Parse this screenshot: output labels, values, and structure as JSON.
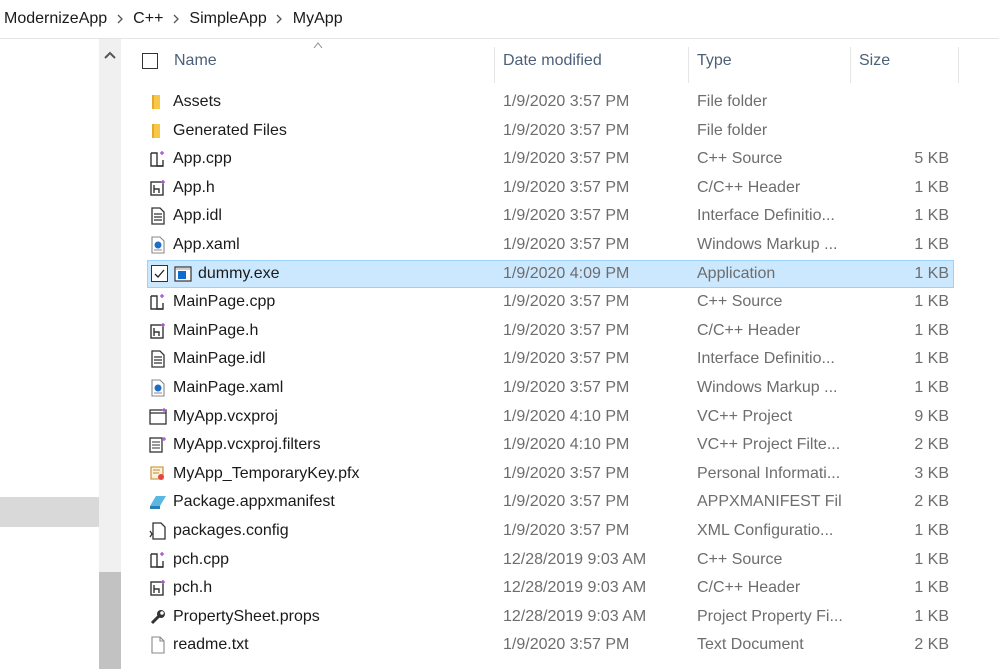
{
  "breadcrumb": [
    "ModernizeApp",
    "C++",
    "SimpleApp",
    "MyApp"
  ],
  "columns": {
    "name": "Name",
    "date": "Date modified",
    "type": "Type",
    "size": "Size"
  },
  "files": [
    {
      "name": "Assets",
      "date": "1/9/2020 3:57 PM",
      "type": "File folder",
      "size": "",
      "icon": "folder-icon"
    },
    {
      "name": "Generated Files",
      "date": "1/9/2020 3:57 PM",
      "type": "File folder",
      "size": "",
      "icon": "folder-icon"
    },
    {
      "name": "App.cpp",
      "date": "1/9/2020 3:57 PM",
      "type": "C++ Source",
      "size": "5 KB",
      "icon": "cpp-file-icon"
    },
    {
      "name": "App.h",
      "date": "1/9/2020 3:57 PM",
      "type": "C/C++ Header",
      "size": "1 KB",
      "icon": "header-file-icon"
    },
    {
      "name": "App.idl",
      "date": "1/9/2020 3:57 PM",
      "type": "Interface Definitio...",
      "size": "1 KB",
      "icon": "text-file-icon"
    },
    {
      "name": "App.xaml",
      "date": "1/9/2020 3:57 PM",
      "type": "Windows Markup ...",
      "size": "1 KB",
      "icon": "xaml-file-icon"
    },
    {
      "name": "dummy.exe",
      "date": "1/9/2020 4:09 PM",
      "type": "Application",
      "size": "1 KB",
      "icon": "application-icon",
      "selected": true
    },
    {
      "name": "MainPage.cpp",
      "date": "1/9/2020 3:57 PM",
      "type": "C++ Source",
      "size": "1 KB",
      "icon": "cpp-file-icon"
    },
    {
      "name": "MainPage.h",
      "date": "1/9/2020 3:57 PM",
      "type": "C/C++ Header",
      "size": "1 KB",
      "icon": "header-file-icon"
    },
    {
      "name": "MainPage.idl",
      "date": "1/9/2020 3:57 PM",
      "type": "Interface Definitio...",
      "size": "1 KB",
      "icon": "text-file-icon"
    },
    {
      "name": "MainPage.xaml",
      "date": "1/9/2020 3:57 PM",
      "type": "Windows Markup ...",
      "size": "1 KB",
      "icon": "xaml-file-icon"
    },
    {
      "name": "MyApp.vcxproj",
      "date": "1/9/2020 4:10 PM",
      "type": "VC++ Project",
      "size": "9 KB",
      "icon": "vcxproj-file-icon"
    },
    {
      "name": "MyApp.vcxproj.filters",
      "date": "1/9/2020 4:10 PM",
      "type": "VC++ Project Filte...",
      "size": "2 KB",
      "icon": "filters-file-icon"
    },
    {
      "name": "MyApp_TemporaryKey.pfx",
      "date": "1/9/2020 3:57 PM",
      "type": "Personal Informati...",
      "size": "3 KB",
      "icon": "certificate-file-icon"
    },
    {
      "name": "Package.appxmanifest",
      "date": "1/9/2020 3:57 PM",
      "type": "APPXMANIFEST File",
      "size": "2 KB",
      "icon": "manifest-file-icon"
    },
    {
      "name": "packages.config",
      "date": "1/9/2020 3:57 PM",
      "type": "XML Configuratio...",
      "size": "1 KB",
      "icon": "config-file-icon"
    },
    {
      "name": "pch.cpp",
      "date": "12/28/2019 9:03 AM",
      "type": "C++ Source",
      "size": "1 KB",
      "icon": "cpp-file-icon"
    },
    {
      "name": "pch.h",
      "date": "12/28/2019 9:03 AM",
      "type": "C/C++ Header",
      "size": "1 KB",
      "icon": "header-file-icon"
    },
    {
      "name": "PropertySheet.props",
      "date": "12/28/2019 9:03 AM",
      "type": "Project Property Fi...",
      "size": "1 KB",
      "icon": "wrench-file-icon"
    },
    {
      "name": "readme.txt",
      "date": "1/9/2020 3:57 PM",
      "type": "Text Document",
      "size": "2 KB",
      "icon": "blank-file-icon"
    }
  ],
  "colors": {
    "selection": "#cce8ff",
    "selection_border": "#99d1ff",
    "header_text": "#4c607a",
    "folder": "#f8c74a"
  }
}
